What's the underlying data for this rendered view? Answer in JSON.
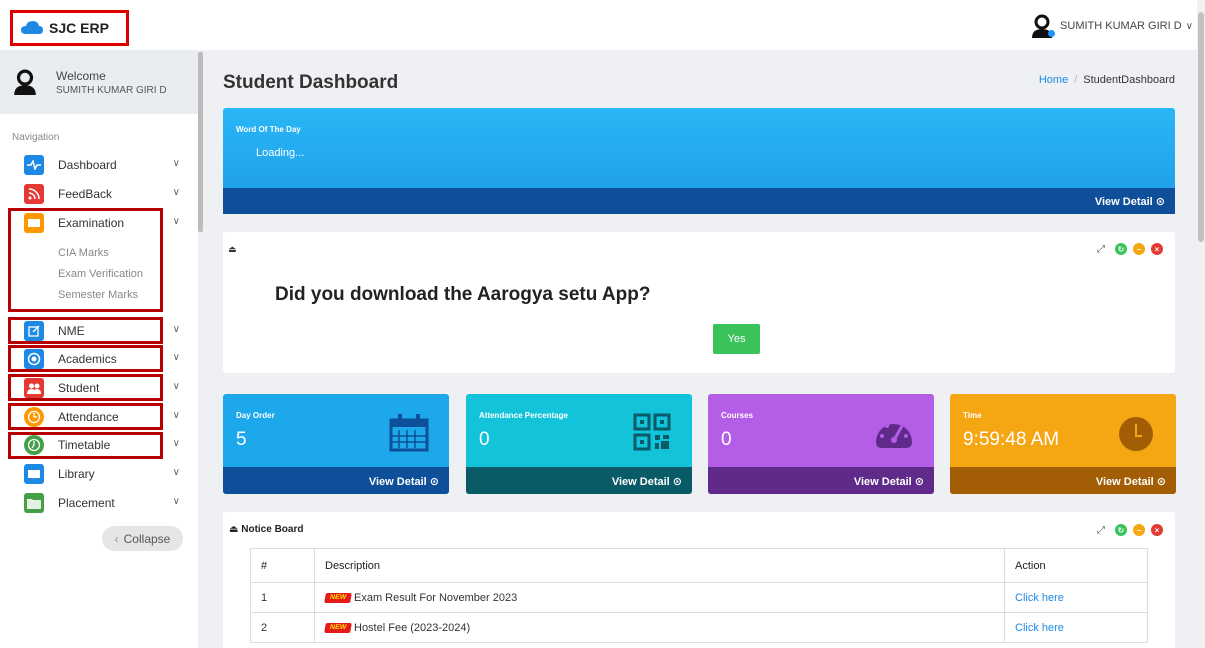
{
  "app": {
    "logo_text": "SJC ERP",
    "user_name": "SUMITH KUMAR GIRI D"
  },
  "sidebar": {
    "welcome_title": "Welcome",
    "welcome_name": "SUMITH KUMAR GIRI D",
    "nav_heading": "Navigation",
    "items": [
      {
        "label": "Dashboard",
        "icon": "pulse-icon",
        "color": "#1e88e5"
      },
      {
        "label": "FeedBack",
        "icon": "rss-icon",
        "color": "#e53935"
      },
      {
        "label": "Examination",
        "icon": "book-icon",
        "color": "#ff9800"
      },
      {
        "label": "NME",
        "icon": "edit-icon",
        "color": "#1e88e5"
      },
      {
        "label": "Academics",
        "icon": "target-icon",
        "color": "#1e88e5"
      },
      {
        "label": "Student",
        "icon": "users-icon",
        "color": "#e53935"
      },
      {
        "label": "Attendance",
        "icon": "clock-icon",
        "color": "#ff9800"
      },
      {
        "label": "Timetable",
        "icon": "clock-icon",
        "color": "#43a047"
      },
      {
        "label": "Library",
        "icon": "book-icon",
        "color": "#1e88e5"
      },
      {
        "label": "Placement",
        "icon": "folder-icon",
        "color": "#43a047"
      }
    ],
    "exam_sub": [
      "CIA Marks",
      "Exam Verification",
      "Semester Marks"
    ],
    "collapse_label": "Collapse"
  },
  "main": {
    "title": "Student Dashboard",
    "breadcrumb": {
      "home": "Home",
      "current": "StudentDashboard"
    },
    "word_of_day": {
      "label": "Word Of The Day",
      "value": "Loading...",
      "view_detail": "View Detail"
    },
    "aarogya": {
      "question": "Did you download the Aarogya setu App?",
      "yes": "Yes"
    },
    "stats": [
      {
        "label": "Day Order",
        "value": "5",
        "view_detail": "View Detail",
        "color": "#1ea8ec",
        "foot": "#0d4f98",
        "icon": "calendar-icon"
      },
      {
        "label": "Attendance Percentage",
        "value": "0",
        "view_detail": "View Detail",
        "color": "#13c3da",
        "foot": "#0a5b68",
        "icon": "qr-icon"
      },
      {
        "label": "Courses",
        "value": "0",
        "view_detail": "View Detail",
        "color": "#b45ee8",
        "foot": "#5f2a8a",
        "icon": "speedometer-icon"
      },
      {
        "label": "Time",
        "value": "9:59:48 AM",
        "view_detail": "View Detail",
        "color": "#f5a613",
        "foot": "#a25d05",
        "icon": "clock-icon"
      }
    ],
    "notice": {
      "title": "Notice Board",
      "headers": [
        "#",
        "Description",
        "Action"
      ],
      "rows": [
        {
          "num": "1",
          "desc": "Exam Result For November 2023",
          "action": "Click here"
        },
        {
          "num": "2",
          "desc": "Hostel Fee (2023-2024)",
          "action": "Click here"
        }
      ],
      "badge": "NEW"
    }
  }
}
